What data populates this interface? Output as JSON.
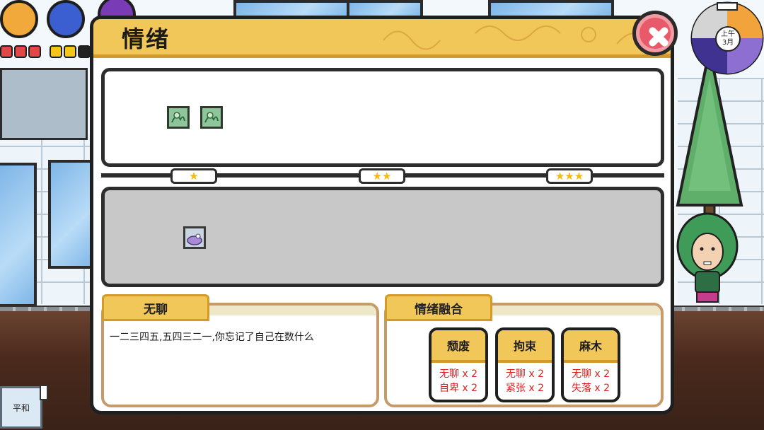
{
  "dialog": {
    "title": "情绪",
    "close_icon": "close-x-icon"
  },
  "clock": {
    "period": "上午",
    "month": "3月"
  },
  "tiers": [
    {
      "label": "★",
      "stars": 1
    },
    {
      "label": "★★",
      "stars": 2
    },
    {
      "label": "★★★",
      "stars": 3
    }
  ],
  "top_slots": [
    {
      "icon": "green-emotion-card-icon"
    },
    {
      "icon": "green-emotion-card-icon"
    }
  ],
  "bottom_slots": [
    {
      "icon": "purple-blob-card-icon"
    }
  ],
  "selected": {
    "name": "无聊",
    "description": "一二三四五,五四三二一,你忘记了自己在数什么"
  },
  "fusion": {
    "title": "情绪融合",
    "recipes": [
      {
        "name": "颓废",
        "req1": "无聊 x 2",
        "req2": "自卑 x 2"
      },
      {
        "name": "拘束",
        "req1": "无聊 x 2",
        "req2": "紧张 x 2"
      },
      {
        "name": "麻木",
        "req1": "无聊 x 2",
        "req2": "失落 x 2"
      }
    ]
  },
  "status": {
    "mood": "平和"
  },
  "colors": {
    "accent_gold": "#f1c75a",
    "border_brown": "#c79a6a",
    "requirement_red": "#e0201f",
    "close_red": "#e85a6a"
  }
}
